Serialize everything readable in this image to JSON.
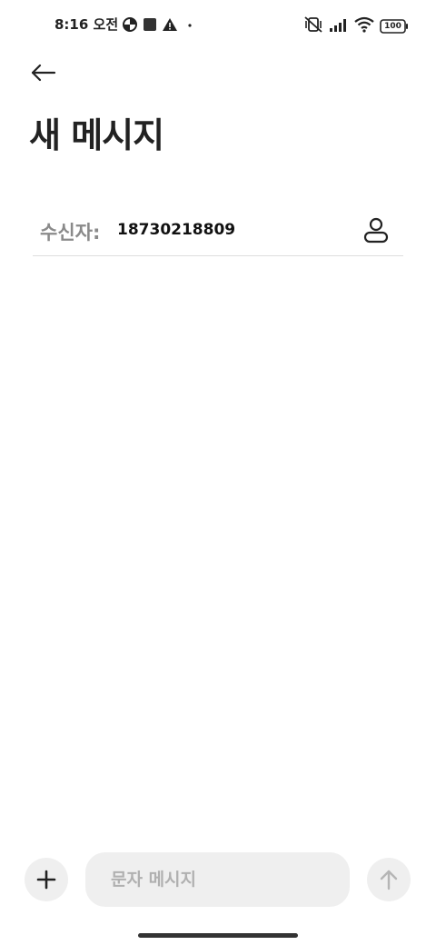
{
  "status_bar": {
    "time": "8:16 오전",
    "battery": "100",
    "icons_left": [
      "data-saver-icon",
      "square-notification-icon",
      "warning-icon",
      "dot-icon"
    ],
    "icons_right": [
      "vibrate-off-icon",
      "signal-icon",
      "wifi-icon",
      "battery-icon"
    ]
  },
  "header": {
    "back_icon": "back-arrow-icon",
    "title": "새 메시지"
  },
  "recipient": {
    "label": "수신자:",
    "value": "18730218809",
    "contact_icon": "person-icon"
  },
  "composer": {
    "add_icon": "plus-icon",
    "placeholder": "문자 메시지",
    "value": "",
    "send_icon": "arrow-up-icon"
  }
}
